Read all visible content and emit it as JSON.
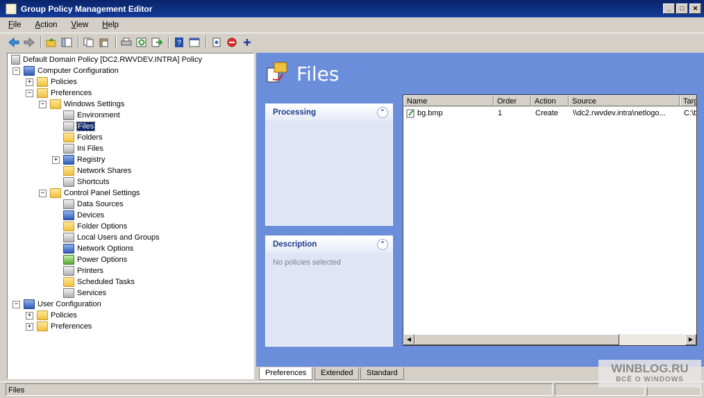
{
  "window": {
    "title": "Group Policy Management Editor"
  },
  "menu": [
    {
      "u": "F",
      "rest": "ile"
    },
    {
      "u": "A",
      "rest": "ction"
    },
    {
      "u": "V",
      "rest": "iew"
    },
    {
      "u": "H",
      "rest": "elp"
    }
  ],
  "toolbar_icons": [
    "back-icon",
    "forward-icon",
    "up-icon",
    "show-hide-tree-icon",
    "copy-icon",
    "paste-icon",
    "print-icon",
    "refresh-icon",
    "export-icon",
    "help-icon",
    "properties-icon",
    "new-item-icon",
    "stop-icon",
    "add-icon"
  ],
  "tree": {
    "root": "Default Domain Policy [DC2.RWVDEV.INTRA] Policy",
    "computer_configuration": "Computer Configuration",
    "cc_policies": "Policies",
    "cc_preferences": "Preferences",
    "windows_settings": "Windows Settings",
    "ws_items": [
      "Environment",
      "Files",
      "Folders",
      "Ini Files",
      "Registry",
      "Network Shares",
      "Shortcuts"
    ],
    "control_panel_settings": "Control Panel Settings",
    "cp_items": [
      "Data Sources",
      "Devices",
      "Folder Options",
      "Local Users and Groups",
      "Network Options",
      "Power Options",
      "Printers",
      "Scheduled Tasks",
      "Services"
    ],
    "user_configuration": "User Configuration",
    "uc_policies": "Policies",
    "uc_preferences": "Preferences",
    "expanders": {
      "plus": "+",
      "minus": "−"
    }
  },
  "right": {
    "title": "Files",
    "processing": {
      "title": "Processing",
      "chevron": "⌃"
    },
    "description": {
      "title": "Description",
      "body": "No policies selected",
      "chevron": "⌃"
    },
    "columns": [
      "Name",
      "Order",
      "Action",
      "Source",
      "Targ"
    ],
    "rows": [
      {
        "name": "bg.bmp",
        "order": "1",
        "action": "Create",
        "source": "\\\\dc2.rwvdev.intra\\netlogo...",
        "target": "C:\\b"
      }
    ]
  },
  "tabs": [
    "Preferences",
    "Extended",
    "Standard"
  ],
  "status": {
    "text": "Files"
  },
  "watermark": {
    "line1": "WINBLOG.RU",
    "line2": "ВСЁ О WINDOWS"
  }
}
